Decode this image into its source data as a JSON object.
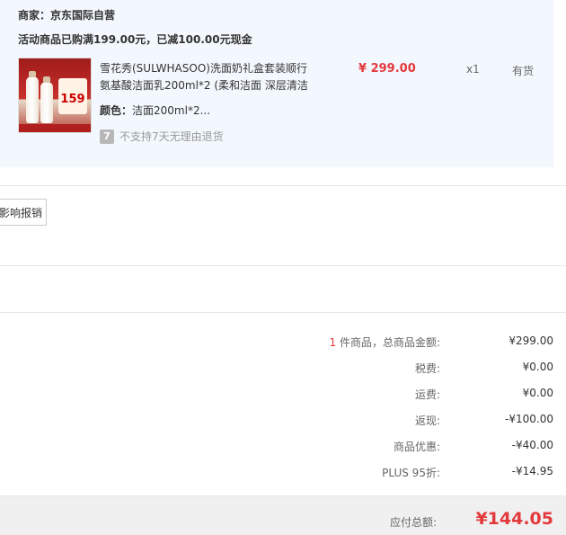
{
  "order": {
    "shop_name": "商家：京东国际自营",
    "promo": "活动商品已购满199.00元，已减100.00元现金",
    "item": {
      "title": "雪花秀(SULWHASOO)洗面奶礼盒套装顺行氨基酸洁面乳200ml*2 (柔和洁面 深层清洁",
      "price": "¥ 299.00",
      "quantity": "x1",
      "stock": "有货",
      "spec_label": "颜色：",
      "spec_value": "洁面200ml*2...",
      "return_policy": "不支持7天无理由退货",
      "return_icon_glyph": "7",
      "thumb_badge": "159"
    }
  },
  "reimbursement_button": "影响报销",
  "summary": {
    "count": "1",
    "count_suffix": " 件商品，总商品金额:",
    "total_goods": "¥299.00",
    "tax_label": "税费:",
    "tax": "¥0.00",
    "shipping_label": "运费:",
    "shipping": "¥0.00",
    "cashback_label": "返现:",
    "cashback": "-¥100.00",
    "discount_label": "商品优惠:",
    "discount": "-¥40.00",
    "plus_label": "PLUS 95折:",
    "plus": "-¥14.95"
  },
  "total": {
    "label": "应付总额:",
    "value": "¥144.05"
  },
  "colors": {
    "price_red": "#e4393c",
    "panel_bg": "#f3f8fe"
  }
}
